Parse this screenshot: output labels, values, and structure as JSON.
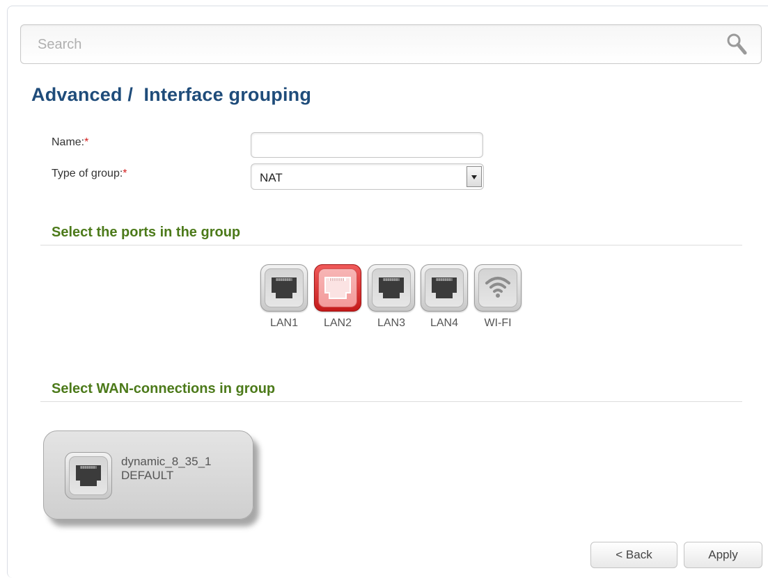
{
  "search": {
    "placeholder": "Search",
    "icon": "search-icon"
  },
  "page": {
    "title": "Advanced /  Interface grouping"
  },
  "form": {
    "name_label": "Name:",
    "name_value": "",
    "type_label": "Type of group:",
    "type_value": "NAT",
    "required_mark": "*"
  },
  "ports_section": {
    "title": "Select the ports in the group",
    "ports": [
      {
        "label": "LAN1",
        "icon": "ethernet-port-icon",
        "selected": false
      },
      {
        "label": "LAN2",
        "icon": "ethernet-port-icon",
        "selected": true
      },
      {
        "label": "LAN3",
        "icon": "ethernet-port-icon",
        "selected": false
      },
      {
        "label": "LAN4",
        "icon": "ethernet-port-icon",
        "selected": false
      },
      {
        "label": "WI-FI",
        "icon": "wifi-icon",
        "selected": false
      }
    ]
  },
  "wan_section": {
    "title": "Select WAN-connections in group",
    "connections": [
      {
        "name": "dynamic_8_35_1",
        "status": "DEFAULT",
        "icon": "ethernet-port-icon"
      }
    ]
  },
  "buttons": {
    "back": "< Back",
    "apply": "Apply"
  },
  "colors": {
    "title": "#1f4c7a",
    "section_title": "#4c7a1a",
    "selected_port": "#d42a2a",
    "required": "#d32020"
  }
}
